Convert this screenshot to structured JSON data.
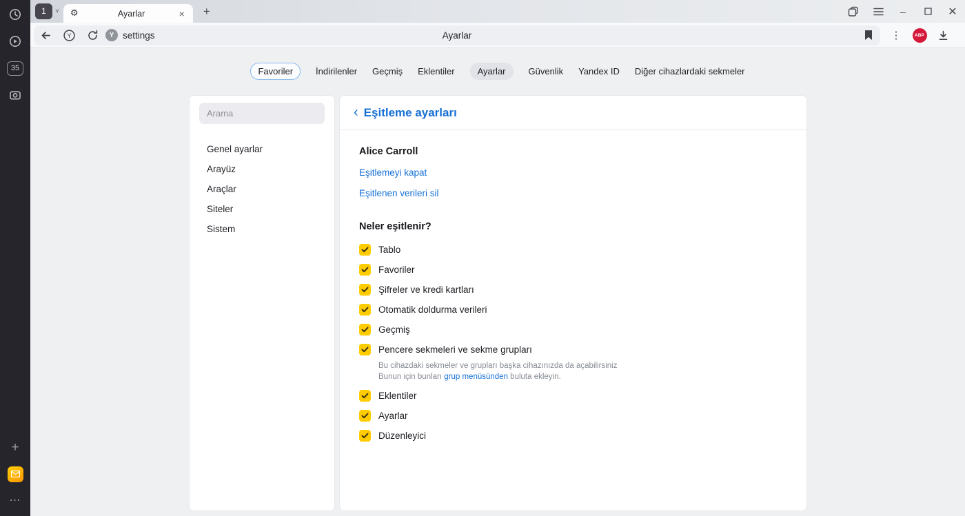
{
  "colors": {
    "accent_blue": "#1670d6",
    "checkbox_yellow": "#ffcc00",
    "abp_red": "#d5173a",
    "rail_bg": "#26252c"
  },
  "rail": {
    "tab_count": "35",
    "plus_glyph": "+",
    "more_glyph": "⋯"
  },
  "tabstrip": {
    "counter": "1",
    "chevron_glyph": "˅",
    "gear_glyph": "⚙",
    "tab_title": "Ayarlar",
    "close_glyph": "×",
    "newtab_glyph": "+",
    "minimize_glyph": "–",
    "close_window_glyph": "✕"
  },
  "toolbar": {
    "url_text": "settings",
    "favicon_letter": "Y",
    "protect_letter": "Y",
    "page_title": "Ayarlar",
    "menu_glyph": "⋮",
    "abp_label": "ABP"
  },
  "nav": {
    "items": [
      "Favoriler",
      "İndirilenler",
      "Geçmiş",
      "Eklentiler",
      "Ayarlar",
      "Güvenlik",
      "Yandex ID",
      "Diğer cihazlardaki sekmeler"
    ]
  },
  "sidebar": {
    "search_placeholder": "Arama",
    "items": [
      "Genel ayarlar",
      "Arayüz",
      "Araçlar",
      "Siteler",
      "Sistem"
    ]
  },
  "main": {
    "back_glyph": "‹",
    "title": "Eşitleme ayarları",
    "account_name": "Alice Carroll",
    "link_disable": "Eşitlemeyi kapat",
    "link_delete": "Eşitlenen verileri sil",
    "section_title": "Neler eşitlenir?",
    "sync": {
      "items": [
        "Tablo",
        "Favoriler",
        "Şifreler ve kredi kartları",
        "Otomatik doldurma verileri",
        "Geçmiş",
        "Pencere sekmeleri ve sekme grupları",
        "Eklentiler",
        "Ayarlar",
        "Düzenleyici"
      ],
      "note_line1": "Bu cihazdaki sekmeler ve grupları başka cihazınızda da açabilirsiniz",
      "note_prefix": "Bunun için bunları ",
      "note_link": "grup menüsünden",
      "note_suffix": " buluta ekleyin."
    }
  }
}
